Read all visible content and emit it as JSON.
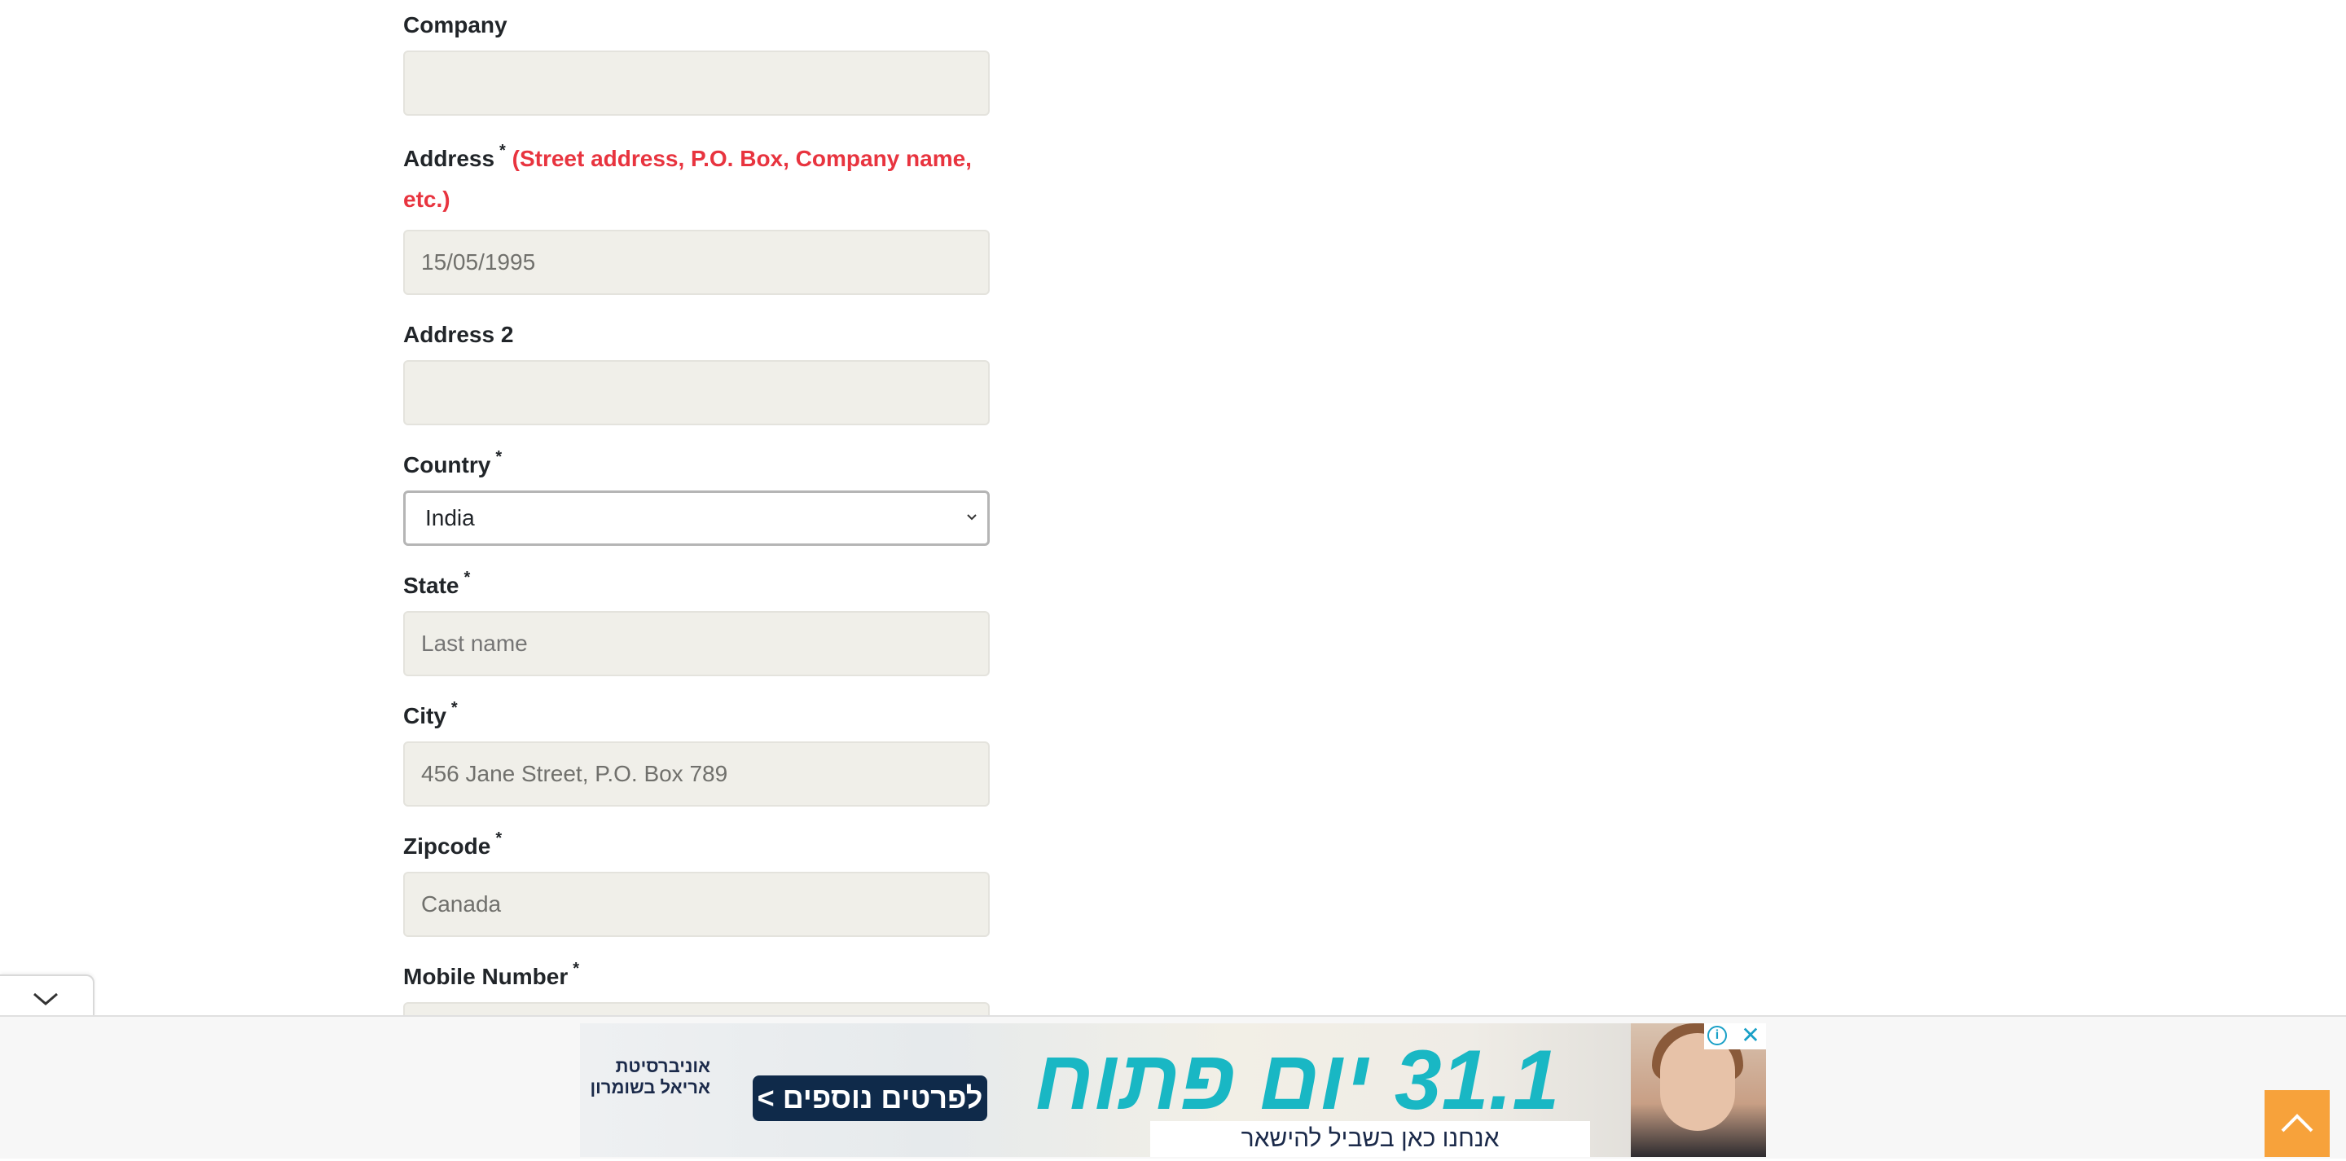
{
  "form": {
    "company": {
      "label": "Company",
      "value": ""
    },
    "address": {
      "label": "Address",
      "required": "*",
      "hint_line1": "(Street address, P.O. Box, Company name,",
      "hint_line2": "etc.)",
      "value": "15/05/1995"
    },
    "address2": {
      "label": "Address 2",
      "value": ""
    },
    "country": {
      "label": "Country",
      "required": "*",
      "selected": "India"
    },
    "state": {
      "label": "State",
      "required": "*",
      "placeholder": "Last name"
    },
    "city": {
      "label": "City",
      "required": "*",
      "value": "456 Jane Street, P.O. Box 789"
    },
    "zipcode": {
      "label": "Zipcode",
      "required": "*",
      "value": "Canada"
    },
    "mobile": {
      "label": "Mobile Number",
      "required": "*"
    }
  },
  "ad": {
    "logo_text": "אוניברסיטת אריאל בשומרון",
    "cta": "לפרטים נוספים >",
    "headline": "31.1 יום פתוח",
    "subline": "אנחנו כאן בשביל להישאר",
    "info_symbol": "i",
    "close_symbol": "✕"
  },
  "icons": {
    "collapse": "chevron-down-icon",
    "scroll_top": "chevron-up-icon",
    "select": "chevron-down-icon"
  },
  "colors": {
    "required_hint": "#e8343f",
    "field_bg": "#f0efe9",
    "scroll_top_bg": "#f7a23b",
    "ad_headline": "#19b7c4"
  }
}
